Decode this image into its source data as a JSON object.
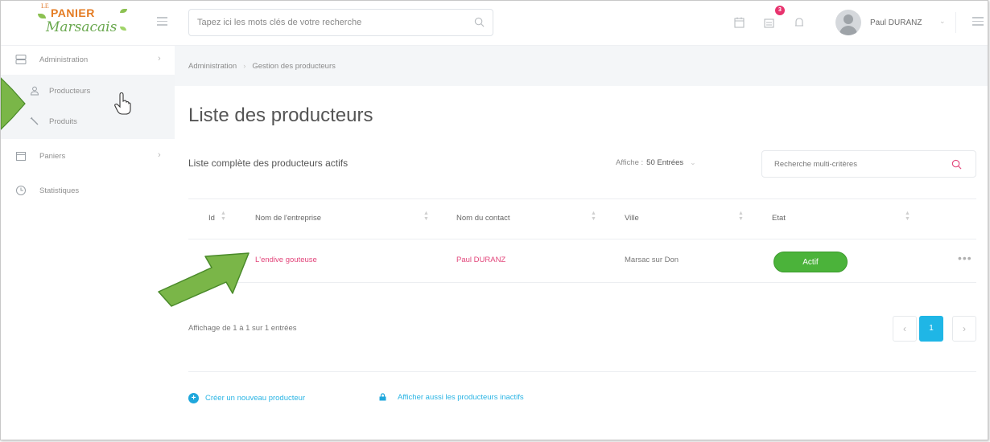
{
  "header": {
    "logo_top": "LE",
    "logo_main": "PANIER",
    "logo_script": "Marsacais",
    "search_placeholder": "Tapez ici les mots clés de votre recherche",
    "notification_count": "3",
    "username": "Paul DURANZ"
  },
  "sidebar": {
    "items": [
      {
        "label": "Administration",
        "icon": "server-icon"
      },
      {
        "label": "Paniers",
        "icon": "calendar-icon"
      },
      {
        "label": "Statistiques",
        "icon": "clock-icon"
      }
    ],
    "subitems": [
      {
        "label": "Producteurs",
        "icon": "user-icon"
      },
      {
        "label": "Produits",
        "icon": "carrot-icon"
      }
    ]
  },
  "breadcrumb": [
    "Administration",
    "Gestion des producteurs"
  ],
  "page": {
    "title": "Liste des producteurs",
    "subtitle": "Liste complète des producteurs actifs",
    "show_label": "Affiche :",
    "show_value": "50 Entrées",
    "filter_placeholder": "Recherche multi-critères"
  },
  "table": {
    "headers": [
      "Id",
      "Nom de l'entreprise",
      "Nom du contact",
      "Ville",
      "Etat"
    ],
    "rows": [
      {
        "company": "L'endive gouteuse",
        "contact": "Paul DURANZ",
        "city": "Marsac sur Don",
        "status": "Actif",
        "more": "•••"
      }
    ]
  },
  "pagination": {
    "info": "Affichage de 1 à 1 sur 1 entrées",
    "prev": "‹",
    "current": "1",
    "next": "›"
  },
  "actions": {
    "create": "Créer un nouveau producteur",
    "show_inactive": "Afficher aussi les producteurs inactifs"
  },
  "colors": {
    "accent": "#1fb6e6",
    "link_pink": "#e2457a",
    "status_green": "#4bb33a",
    "annotation_arrow": "#7ab648"
  }
}
